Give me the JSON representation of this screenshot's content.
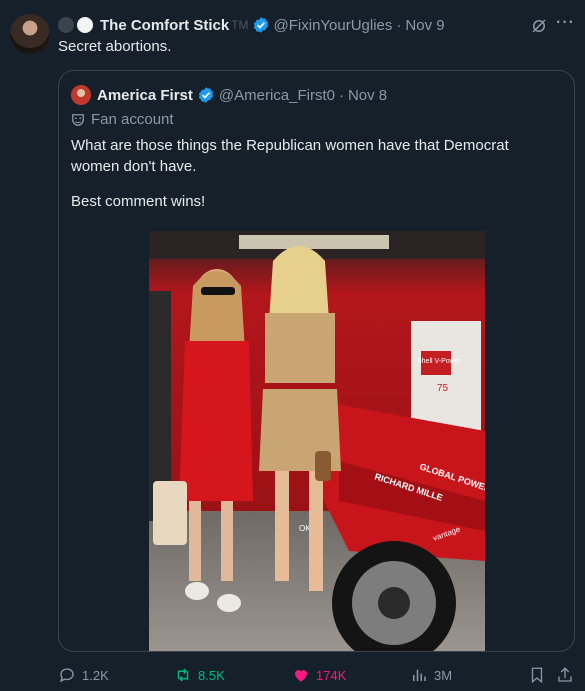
{
  "tweet": {
    "author_name": "The Comfort Stick",
    "author_suffix": "TM",
    "handle": "@FixinYourUglies",
    "separator": "·",
    "date": "Nov 9",
    "text": "Secret abortions.",
    "more_icon": "more-icon"
  },
  "quoted": {
    "author_name": "America First",
    "handle": "@America_First0",
    "separator": "·",
    "date": "Nov 8",
    "badge": "Fan account",
    "text_line1": "What are those things the Republican women have that Democrat women don't have.",
    "text_line2": "Best comment wins!",
    "photo_text": {
      "car_brand": "Shell V-Power",
      "number": "75",
      "sponsor1": "RICHARD MILLE",
      "sponsor2": "GLOBAL POWER",
      "sponsor3": "vantage",
      "sponsor4": "OKX"
    }
  },
  "actions": {
    "replies": "1.2K",
    "reposts": "8.5K",
    "likes": "174K",
    "views": "3M"
  },
  "colors": {
    "background": "#15202b",
    "verified": "#1d9bf0",
    "repost": "#00ba7c",
    "like": "#f91880",
    "muted": "#8b98a5"
  }
}
